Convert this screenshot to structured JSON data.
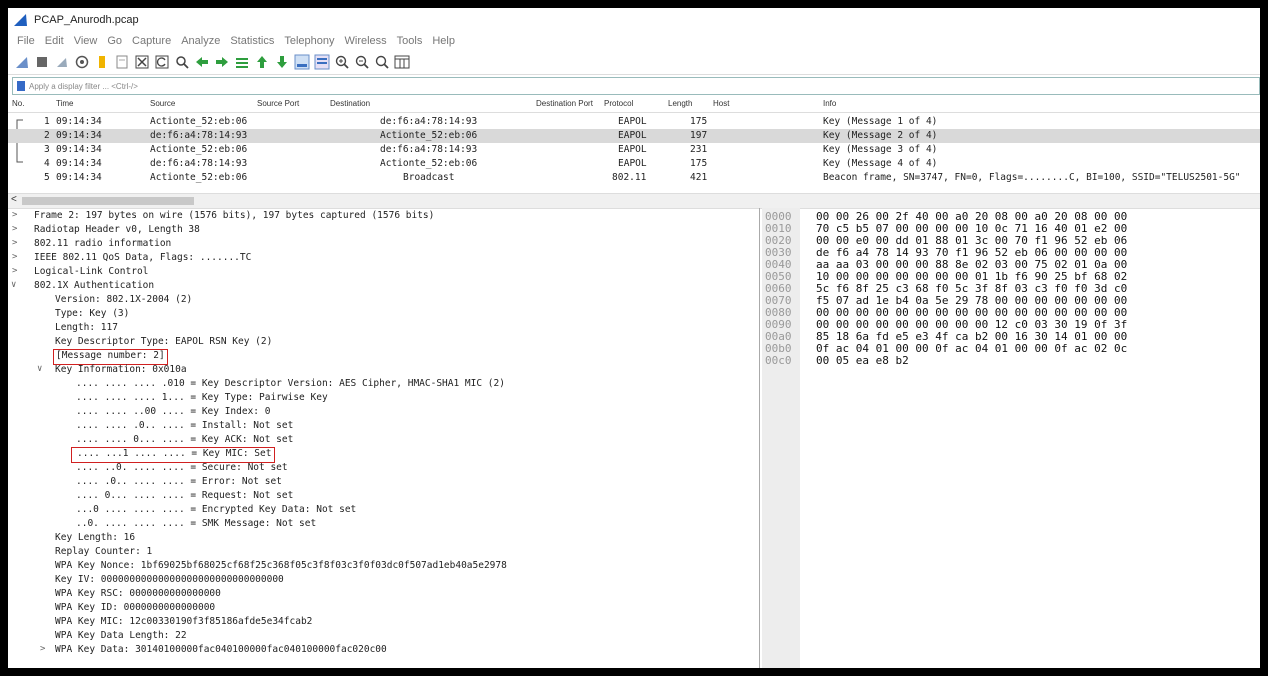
{
  "window": {
    "title": "PCAP_Anurodh.pcap"
  },
  "menu": [
    "File",
    "Edit",
    "View",
    "Go",
    "Capture",
    "Analyze",
    "Statistics",
    "Telephony",
    "Wireless",
    "Tools",
    "Help"
  ],
  "filter": {
    "placeholder": "Apply a display filter ... <Ctrl-/>"
  },
  "columns": [
    "No.",
    "Time",
    "Source",
    "Source Port",
    "Destination",
    "Destination Port",
    "Protocol",
    "Length",
    "Host",
    "Info"
  ],
  "packets": [
    {
      "no": "1",
      "time": "09:14:34",
      "src": "Actionte_52:eb:06",
      "dst": "de:f6:a4:78:14:93",
      "proto": "EAPOL",
      "len": "175",
      "info": "Key (Message 1 of 4)"
    },
    {
      "no": "2",
      "time": "09:14:34",
      "src": "de:f6:a4:78:14:93",
      "dst": "Actionte_52:eb:06",
      "proto": "EAPOL",
      "len": "197",
      "info": "Key (Message 2 of 4)"
    },
    {
      "no": "3",
      "time": "09:14:34",
      "src": "Actionte_52:eb:06",
      "dst": "de:f6:a4:78:14:93",
      "proto": "EAPOL",
      "len": "231",
      "info": "Key (Message 3 of 4)"
    },
    {
      "no": "4",
      "time": "09:14:34",
      "src": "de:f6:a4:78:14:93",
      "dst": "Actionte_52:eb:06",
      "proto": "EAPOL",
      "len": "175",
      "info": "Key (Message 4 of 4)"
    },
    {
      "no": "5",
      "time": "09:14:34",
      "src": "Actionte_52:eb:06",
      "dst": "Broadcast",
      "proto": "802.11",
      "len": "421",
      "info": "Beacon frame, SN=3747, FN=0, Flags=........C, BI=100, SSID=\"TELUS2501-5G\""
    }
  ],
  "details": [
    "Frame 2: 197 bytes on wire (1576 bits), 197 bytes captured (1576 bits)",
    "Radiotap Header v0, Length 38",
    "802.11 radio information",
    "IEEE 802.11 QoS Data, Flags: .......TC",
    "Logical-Link Control",
    "802.1X Authentication",
    "Version: 802.1X-2004 (2)",
    "Type: Key (3)",
    "Length: 117",
    "Key Descriptor Type: EAPOL RSN Key (2)",
    "[Message number: 2]",
    "Key Information: 0x010a",
    ".... .... .... .010 = Key Descriptor Version: AES Cipher, HMAC-SHA1 MIC (2)",
    ".... .... .... 1... = Key Type: Pairwise Key",
    ".... .... ..00 .... = Key Index: 0",
    ".... .... .0.. .... = Install: Not set",
    ".... .... 0... .... = Key ACK: Not set",
    ".... ...1 .... .... = Key MIC: Set",
    ".... ..0. .... .... = Secure: Not set",
    ".... .0.. .... .... = Error: Not set",
    ".... 0... .... .... = Request: Not set",
    "...0 .... .... .... = Encrypted Key Data: Not set",
    "..0. .... .... .... = SMK Message: Not set",
    "Key Length: 16",
    "Replay Counter: 1",
    "WPA Key Nonce: 1bf69025bf68025cf68f25c368f05c3f8f03c3f0f03dc0f507ad1eb40a5e2978",
    "Key IV: 00000000000000000000000000000000",
    "WPA Key RSC: 0000000000000000",
    "WPA Key ID: 0000000000000000",
    "WPA Key MIC: 12c00330190f3f85186afde5e34fcab2",
    "WPA Key Data Length: 22",
    "WPA Key Data: 30140100000fac040100000fac040100000fac020c00"
  ],
  "bytes": [
    {
      "off": "0000",
      "hex": "00 00 26 00 2f 40 00 a0  20 08 00 a0 20 08 00 00"
    },
    {
      "off": "0010",
      "hex": "70 c5 b5 07 00 00 00 00  10 0c 71 16 40 01 e2 00"
    },
    {
      "off": "0020",
      "hex": "00 00 e0 00 dd 01 88 01  3c 00 70 f1 96 52 eb 06"
    },
    {
      "off": "0030",
      "hex": "de f6 a4 78 14 93 70 f1  96 52 eb 06 00 00 00 00"
    },
    {
      "off": "0040",
      "hex": "aa aa 03 00 00 00 88 8e  02 03 00 75 02 01 0a 00"
    },
    {
      "off": "0050",
      "hex": "10 00 00 00 00 00 00 00  01 1b f6 90 25 bf 68 02"
    },
    {
      "off": "0060",
      "hex": "5c f6 8f 25 c3 68 f0 5c  3f 8f 03 c3 f0 f0 3d c0"
    },
    {
      "off": "0070",
      "hex": "f5 07 ad 1e b4 0a 5e 29  78 00 00 00 00 00 00 00"
    },
    {
      "off": "0080",
      "hex": "00 00 00 00 00 00 00 00  00 00 00 00 00 00 00 00"
    },
    {
      "off": "0090",
      "hex": "00 00 00 00 00 00 00 00  00 12 c0 03 30 19 0f 3f"
    },
    {
      "off": "00a0",
      "hex": "85 18 6a fd e5 e3 4f ca  b2 00 16 30 14 01 00 00"
    },
    {
      "off": "00b0",
      "hex": "0f ac 04 01 00 00 0f ac  04 01 00 00 0f ac 02 0c"
    },
    {
      "off": "00c0",
      "hex": "00 05 ea e8 b2"
    }
  ]
}
